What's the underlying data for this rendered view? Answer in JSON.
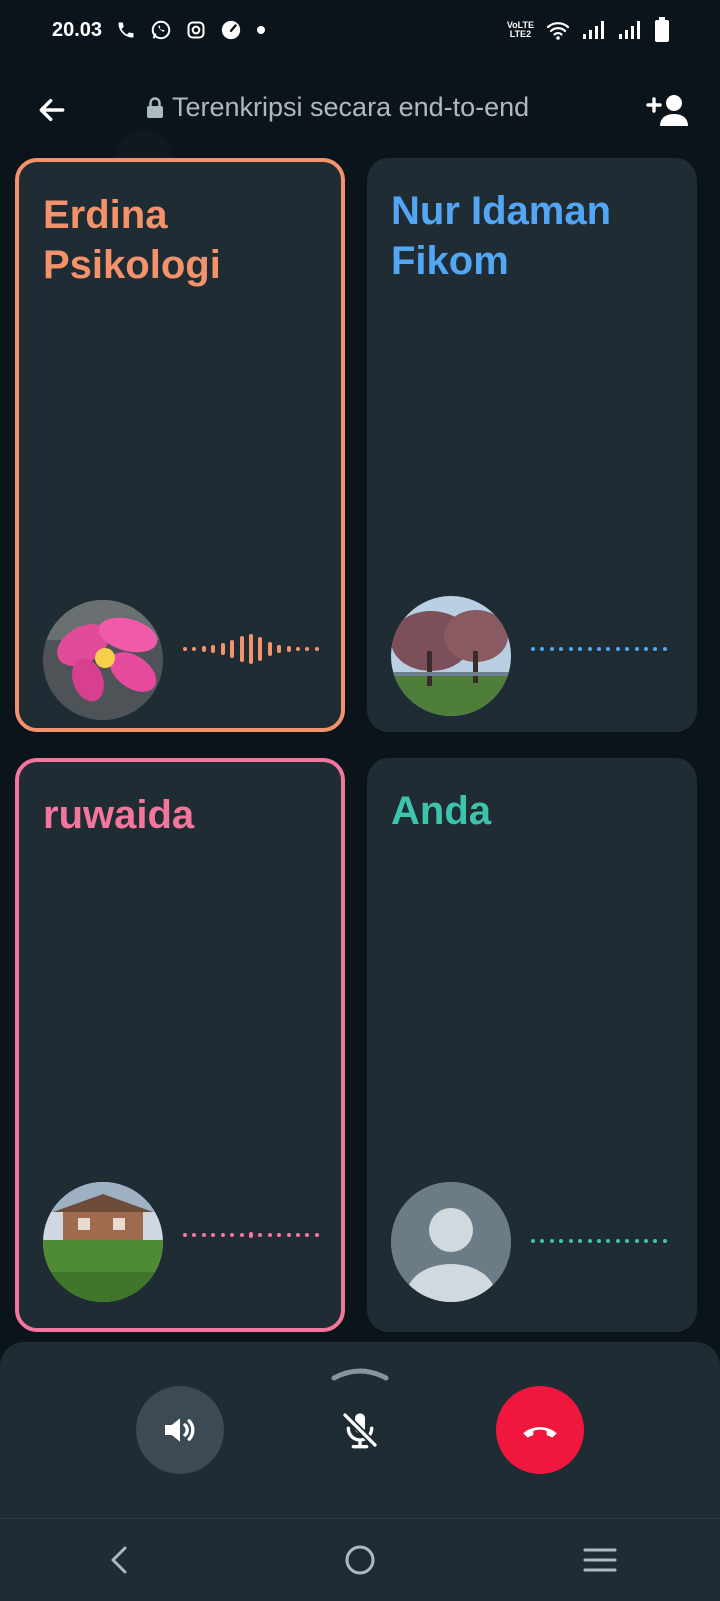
{
  "status_bar": {
    "time": "20.03",
    "network_label_top": "VoLTE",
    "network_label_bottom": "LTE2",
    "icons": [
      "phone-icon",
      "whatsapp-icon",
      "instagram-icon",
      "speed-icon",
      "dot-icon",
      "wifi-icon",
      "signal-icon",
      "signal-icon",
      "battery-icon"
    ]
  },
  "header": {
    "encryption_text": "Terenkripsi secara end-to-end",
    "back_icon": "arrow-left-icon",
    "lock_icon": "lock-icon",
    "add_icon": "add-person-icon"
  },
  "participants": [
    {
      "name": "Erdina Psikologi",
      "color": "#f4936b",
      "speaking": true,
      "avatar": "flower-photo"
    },
    {
      "name": "Nur Idaman Fikom",
      "color": "#53a6f3",
      "speaking": false,
      "avatar": "trees-photo"
    },
    {
      "name": "ruwaida",
      "color": "#f4769c",
      "speaking": true,
      "avatar": "house-photo"
    },
    {
      "name": "Anda",
      "color": "#3ec4ad",
      "speaking": false,
      "avatar": "default-person"
    }
  ],
  "controls": {
    "speaker_icon": "speaker-icon",
    "mute_icon": "mic-off-icon",
    "end_icon": "end-call-icon",
    "end_color": "#f0173f",
    "speaker_bg": "#3b4a54"
  },
  "nav": {
    "icons": [
      "back-nav-icon",
      "home-nav-icon",
      "recents-nav-icon"
    ]
  }
}
